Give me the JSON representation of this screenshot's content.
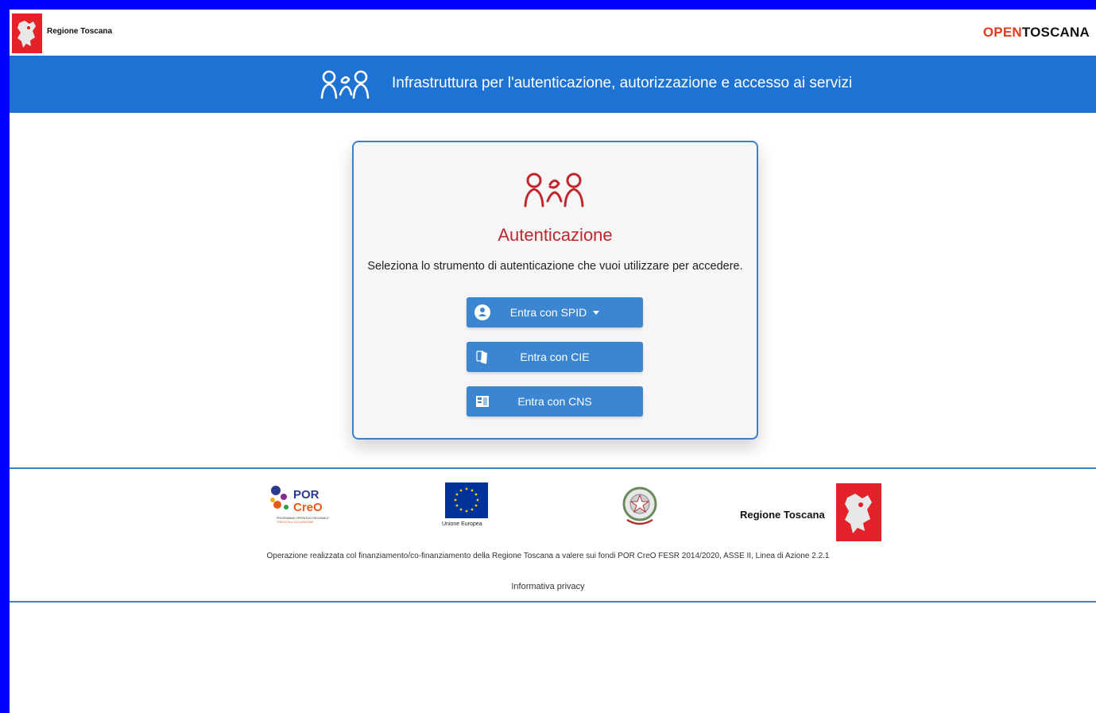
{
  "topbar": {
    "region_name": "Regione Toscana",
    "brand_prefix": "O",
    "brand_highlight": "PEN",
    "brand_rest": "TOSCANA"
  },
  "header": {
    "title": "Infrastruttura per l'autenticazione, autorizzazione e accesso ai servizi",
    "icon": "users-group-icon"
  },
  "card": {
    "title": "Autenticazione",
    "description": "Seleziona lo strumento di autenticazione che vuoi utilizzare per accedere.",
    "buttons": [
      {
        "label": "Entra con SPID",
        "icon": "spid-user-icon",
        "dropdown": true
      },
      {
        "label": "Entra con CIE",
        "icon": "cie-card-icon",
        "dropdown": false
      },
      {
        "label": "Entra con CNS",
        "icon": "cns-card-icon",
        "dropdown": false
      }
    ]
  },
  "footer": {
    "logos": {
      "por_line1": "POR",
      "por_line2": "CreO",
      "por_sub1": "PROGRAMMA OPERATIVO REGIONALE",
      "por_sub2": "CRESCITA e OCCUPAZIONE",
      "eu_label": "Unione Europea",
      "region_name": "Regione Toscana"
    },
    "funding_text": "Operazione realizzata col finanziamento/co-finanziamento della Regione Toscana a valere sui fondi POR CreO FESR 2014/2020, ASSE II, Linea di Azione 2.2.1",
    "privacy_link": "Informativa privacy"
  },
  "colors": {
    "header_blue": "#1e73d2",
    "button_blue": "#3c86d1",
    "title_red": "#c0272d",
    "region_red": "#e32229",
    "frame_blue": "#0000ff"
  }
}
